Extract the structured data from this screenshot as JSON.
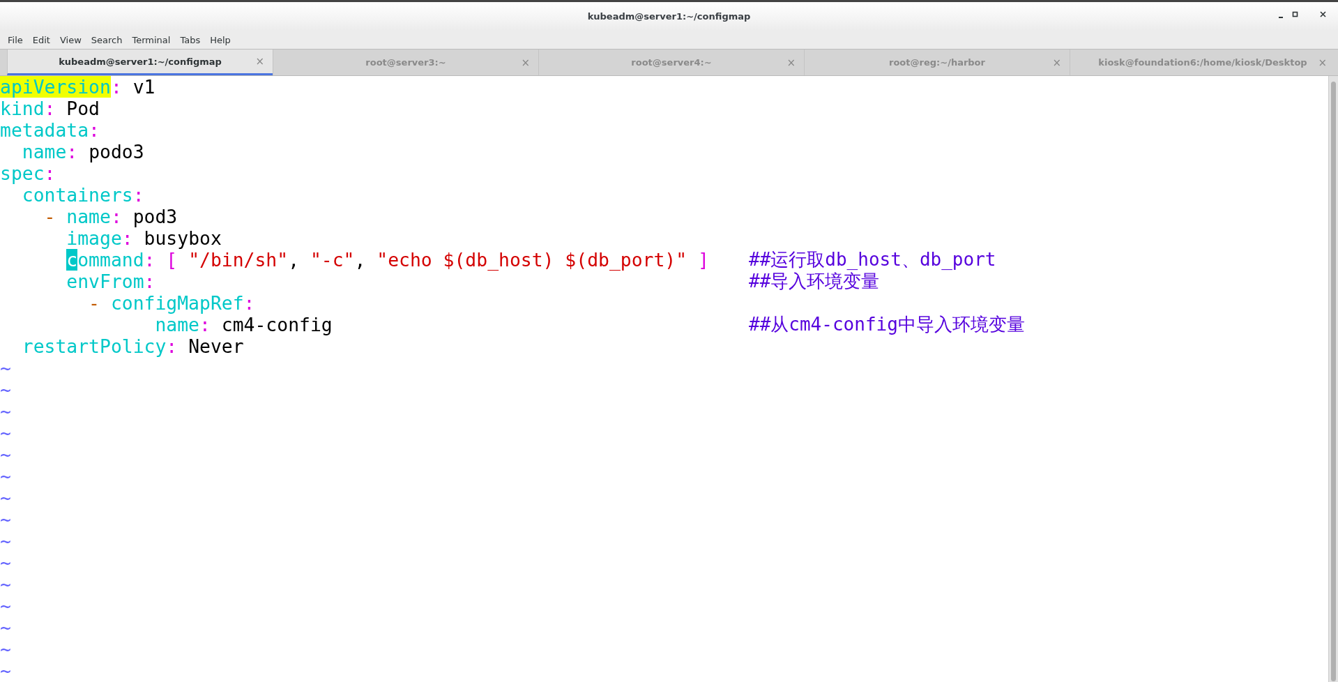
{
  "window": {
    "title": "kubeadm@server1:~/configmap"
  },
  "menu": [
    "File",
    "Edit",
    "View",
    "Search",
    "Terminal",
    "Tabs",
    "Help"
  ],
  "tabs": [
    {
      "label": "kubeadm@server1:~/configmap",
      "close": "×",
      "selected": true
    },
    {
      "label": "root@server3:~",
      "close": "×",
      "selected": false
    },
    {
      "label": "root@server4:~",
      "close": "×",
      "selected": false
    },
    {
      "label": "root@reg:~/harbor",
      "close": "×",
      "selected": false
    },
    {
      "label": "kiosk@foundation6:/home/kiosk/Desktop",
      "close": "×",
      "selected": false
    }
  ],
  "editor": {
    "lines": [
      {
        "tokens": [
          {
            "kind": "match",
            "text": "apiVersion"
          },
          {
            "kind": "punct",
            "text": ":"
          },
          {
            "kind": "value",
            "text": " v1"
          }
        ]
      },
      {
        "tokens": [
          {
            "kind": "key",
            "text": "kind"
          },
          {
            "kind": "punct",
            "text": ":"
          },
          {
            "kind": "value",
            "text": " Pod"
          }
        ]
      },
      {
        "tokens": [
          {
            "kind": "key",
            "text": "metadata"
          },
          {
            "kind": "punct",
            "text": ":"
          }
        ]
      },
      {
        "tokens": [
          {
            "kind": "key",
            "text": "  name"
          },
          {
            "kind": "punct",
            "text": ":"
          },
          {
            "kind": "value",
            "text": " podo3"
          }
        ]
      },
      {
        "tokens": [
          {
            "kind": "key",
            "text": "spec"
          },
          {
            "kind": "punct",
            "text": ":"
          }
        ]
      },
      {
        "tokens": [
          {
            "kind": "key",
            "text": "  containers"
          },
          {
            "kind": "punct",
            "text": ":"
          }
        ]
      },
      {
        "tokens": [
          {
            "kind": "dash",
            "text": "    -"
          },
          {
            "kind": "key",
            "text": " name"
          },
          {
            "kind": "punct",
            "text": ":"
          },
          {
            "kind": "value",
            "text": " pod3"
          }
        ]
      },
      {
        "tokens": [
          {
            "kind": "key",
            "text": "      image"
          },
          {
            "kind": "punct",
            "text": ":"
          },
          {
            "kind": "value",
            "text": " busybox"
          }
        ]
      },
      {
        "tokens": [
          {
            "kind": "cursor",
            "text": "      c"
          },
          {
            "kind": "key",
            "text": "ommand"
          },
          {
            "kind": "punct",
            "text": ": ["
          },
          {
            "kind": "string",
            "text": " \"/bin/sh\""
          },
          {
            "kind": "value",
            "text": ","
          },
          {
            "kind": "string",
            "text": " \"-c\""
          },
          {
            "kind": "value",
            "text": ","
          },
          {
            "kind": "string",
            "text": " \"echo $(db_host) $(db_port)\""
          },
          {
            "kind": "punct",
            "text": " ]"
          }
        ],
        "annotation": "##运行取db_host、db_port"
      },
      {
        "tokens": [
          {
            "kind": "key",
            "text": "      envFrom"
          },
          {
            "kind": "punct",
            "text": ":"
          }
        ],
        "annotation": "##导入环境变量"
      },
      {
        "tokens": [
          {
            "kind": "dash",
            "text": "        -"
          },
          {
            "kind": "key",
            "text": " configMapRef"
          },
          {
            "kind": "punct",
            "text": ":"
          }
        ]
      },
      {
        "tokens": [
          {
            "kind": "key",
            "text": "              name"
          },
          {
            "kind": "punct",
            "text": ":"
          },
          {
            "kind": "value",
            "text": " cm4-config"
          }
        ],
        "annotation": "##从cm4-config中导入环境变量"
      },
      {
        "tokens": [
          {
            "kind": "key",
            "text": "  restartPolicy"
          },
          {
            "kind": "punct",
            "text": ":"
          },
          {
            "kind": "value",
            "text": " Never"
          }
        ]
      }
    ],
    "empty_line_markers": [
      "~",
      "~",
      "~",
      "~",
      "~",
      "~",
      "~",
      "~",
      "~",
      "~",
      "~",
      "~",
      "~",
      "~",
      "~"
    ]
  }
}
